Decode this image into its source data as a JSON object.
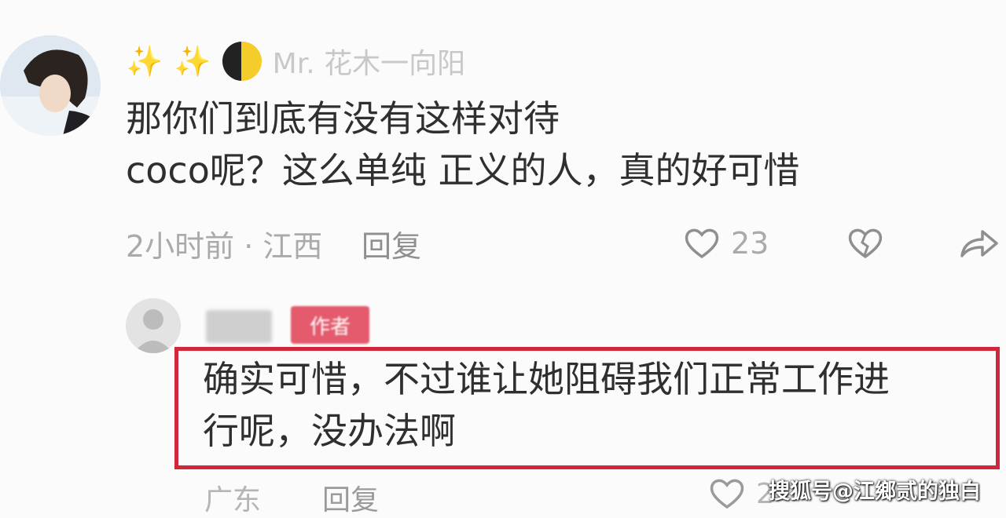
{
  "comment": {
    "username": "Mr. 花木一向阳",
    "text_line1": "那你们到底有没有这样对待",
    "text_line2": "coco呢？这么单纯 正义的人，真的好可惜",
    "time_location": "2小时前 · 江西",
    "reply_label": "回复",
    "like_count": "23"
  },
  "reply": {
    "username": "网民",
    "badge": "作者",
    "text_line1": "确实可惜，不过谁让她阻碍我们正常工作进",
    "text_line2": "行呢，没办法啊",
    "location": "广东",
    "reply_label": "回复",
    "like_count": "2"
  },
  "watermark": "搜狐号@江鄉贰的独白",
  "colors": {
    "highlight_border": "#d2263a",
    "author_badge": "#e35b6d"
  },
  "icons": [
    "sparkle-icon",
    "moon-icon",
    "heart-icon",
    "dislike-icon",
    "share-icon"
  ]
}
